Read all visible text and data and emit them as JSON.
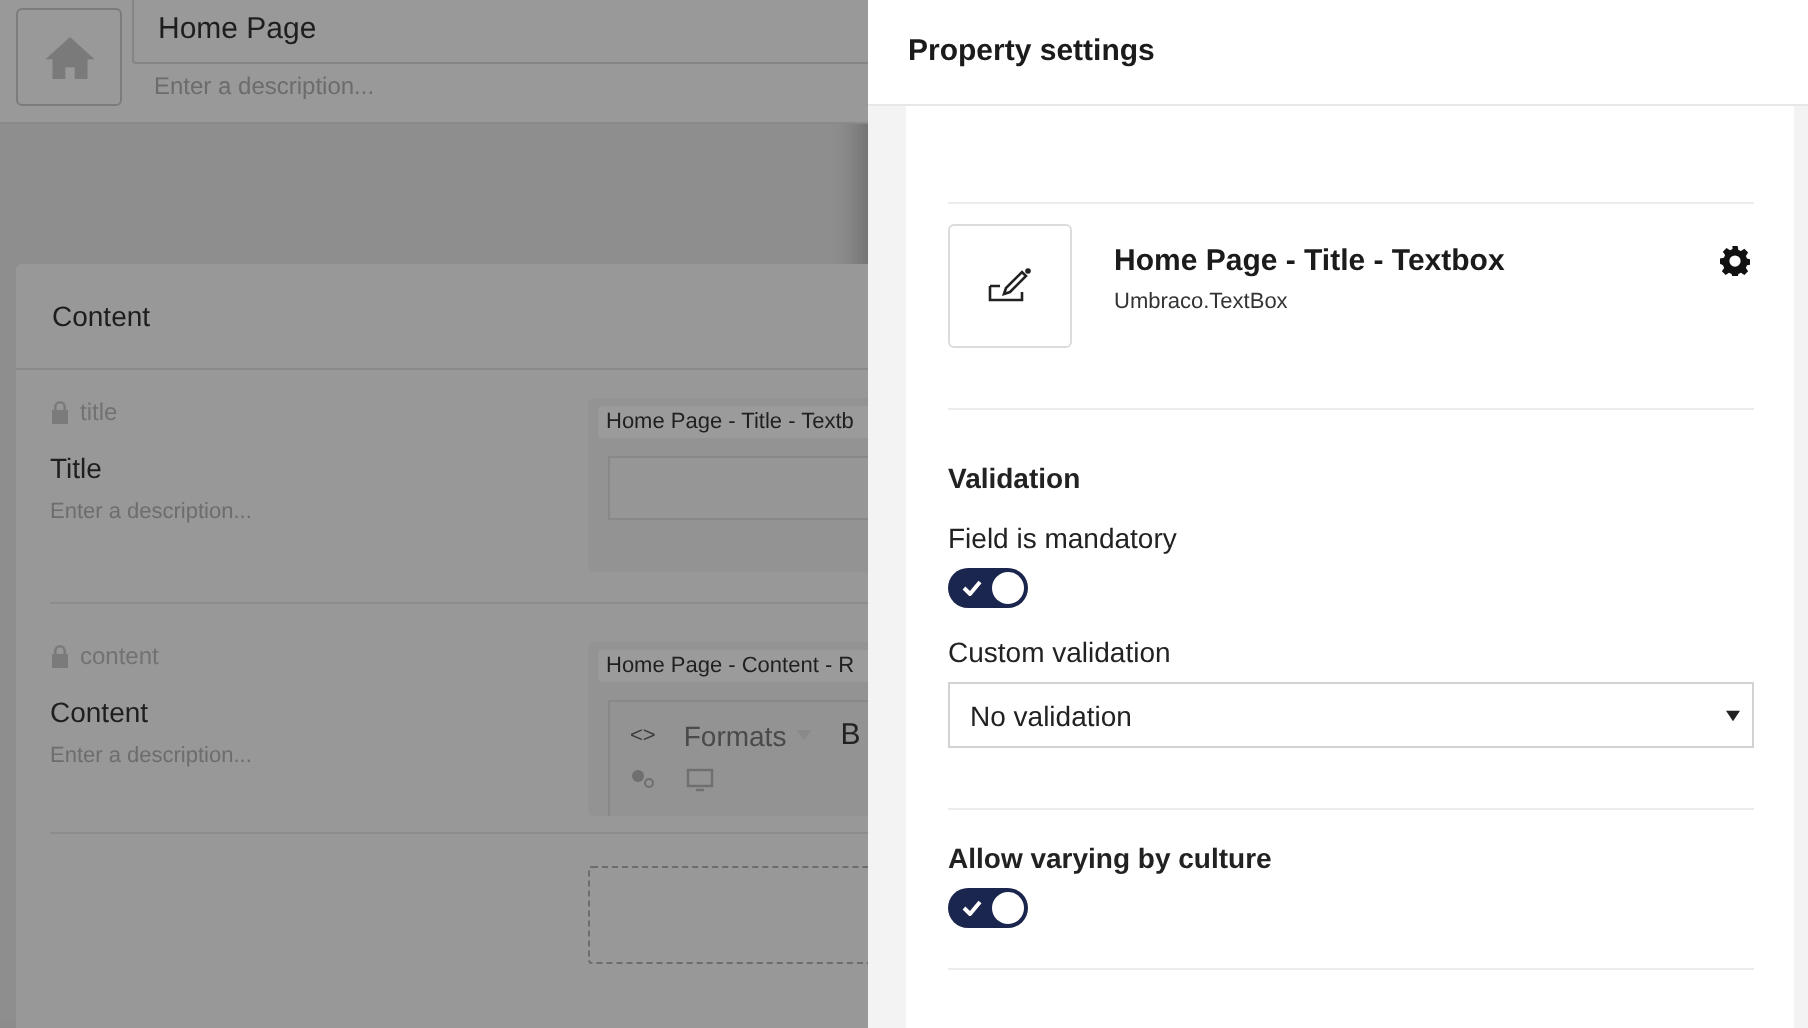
{
  "page_header": {
    "name": "Home Page",
    "description_placeholder": "Enter a description..."
  },
  "content_group": {
    "title": "Content",
    "properties": [
      {
        "kind": "textbox",
        "alias": "title",
        "label": "Title",
        "description_placeholder": "Enter a description...",
        "editor_label": "Home Page - Title - Textb"
      },
      {
        "kind": "richtext",
        "alias": "content",
        "label": "Content",
        "description_placeholder": "Enter a description...",
        "editor_label": "Home Page - Content - R",
        "toolbar": [
          "<>",
          "Formats",
          "B"
        ]
      }
    ]
  },
  "panel": {
    "title": "Property settings",
    "editor": {
      "name": "Home Page - Title - Textbox",
      "alias": "Umbraco.TextBox"
    },
    "validation": {
      "heading": "Validation",
      "mandatory_label": "Field is mandatory",
      "mandatory_on": true,
      "custom_label": "Custom validation",
      "custom_value": "No validation"
    },
    "variation": {
      "label": "Allow varying by culture",
      "on": true
    }
  }
}
